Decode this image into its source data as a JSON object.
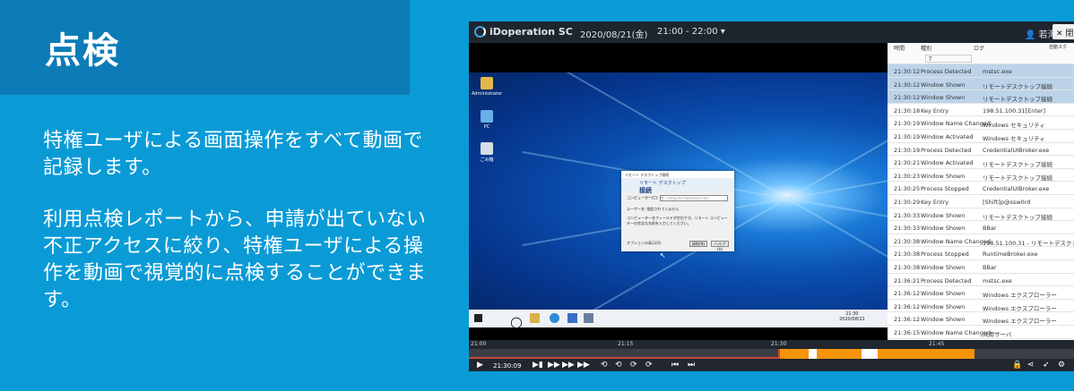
{
  "heading": "点検",
  "description": {
    "p1": "特権ユーザによる画面操作をすべて動画で記録します。",
    "p2": "利用点検レポートから、申請が出ていない不正アクセスに絞り、特権ユーザによる操作を動画で視覚的に点検することができます。"
  },
  "app": {
    "brand": "iDoperation SC",
    "date": "2020/08/21(金)",
    "time_range": "21:00 - 22:00",
    "user": "若海",
    "close_label": "閉じ",
    "header_right": "自動スク"
  },
  "desktop": {
    "icons": [
      "Administrator",
      "PC",
      "ごみ箱"
    ],
    "dialog": {
      "window_title": "リモート デスクトップ接続",
      "header_line1": "リモート デスクトップ",
      "header_line2": "接続",
      "computer_label": "コンピューター(C):",
      "computer_placeholder": "例: computer.fabrikam.com",
      "user_label": "ユーザー名:",
      "user_value": "指定されていません",
      "note": "コンピューター名フィールドが空白です。リモート コンピューターの完全な名前を入力してください。",
      "options": "オプションの表示(O)",
      "connect": "接続(N)",
      "help": "ヘルプ(H)"
    },
    "taskbar_clock": {
      "time": "21:30",
      "date": "2020/08/21"
    }
  },
  "log": {
    "columns": [
      "時間",
      "種別",
      "ログ"
    ],
    "filter_value": "T",
    "rows": [
      {
        "time": "21:30:12",
        "type": "Process Detected",
        "log": "mstsc.exe",
        "selected": true
      },
      {
        "time": "21:30:12",
        "type": "Window Shown",
        "log": "リモートデスクトップ接続",
        "selected": true
      },
      {
        "time": "21:30:12",
        "type": "Window Shown",
        "log": "リモートデスクトップ接続",
        "selected": true
      },
      {
        "time": "21:30:18",
        "type": "Key Entry",
        "log": "198.51.100.31[Enter]",
        "selected": false
      },
      {
        "time": "21:30:19",
        "type": "Window Name Changed",
        "log": "Windows セキュリティ",
        "selected": false
      },
      {
        "time": "21:30:19",
        "type": "Window Activated",
        "log": "Windows セキュリティ",
        "selected": false
      },
      {
        "time": "21:30:19",
        "type": "Process Detected",
        "log": "CredentialUIBroker.exe",
        "selected": false
      },
      {
        "time": "21:30:21",
        "type": "Window Activated",
        "log": "リモートデスクトップ接続",
        "selected": false
      },
      {
        "time": "21:30:23",
        "type": "Window Shown",
        "log": "リモートデスクトップ接続",
        "selected": false
      },
      {
        "time": "21:30:25",
        "type": "Process Stopped",
        "log": "CredentialUIBroker.exe",
        "selected": false
      },
      {
        "time": "21:30:29",
        "type": "Key Entry",
        "log": "[Shift]p@ssw0rd",
        "selected": false
      },
      {
        "time": "21:30:33",
        "type": "Window Shown",
        "log": "リモートデスクトップ接続",
        "selected": false
      },
      {
        "time": "21:30:33",
        "type": "Window Shown",
        "log": "BBar",
        "selected": false
      },
      {
        "time": "21:30:38",
        "type": "Window Name Changed",
        "log": "198.51.100.31 - リモートデスクトップ",
        "selected": false
      },
      {
        "time": "21:30:38",
        "type": "Process Stopped",
        "log": "RuntimeBroker.exe",
        "selected": false
      },
      {
        "time": "21:30:38",
        "type": "Window Shown",
        "log": "BBar",
        "selected": false
      },
      {
        "time": "21:36:21",
        "type": "Process Detected",
        "log": "mstsc.exe",
        "selected": false
      },
      {
        "time": "21:36:12",
        "type": "Window Shown",
        "log": "Windows エクスプローラー",
        "selected": false
      },
      {
        "time": "21:36:12",
        "type": "Window Shown",
        "log": "Windows エクスプローラー",
        "selected": false
      },
      {
        "time": "21:36:12",
        "type": "Window Shown",
        "log": "Windows エクスプローラー",
        "selected": false
      },
      {
        "time": "21:36:15",
        "type": "Window Name Changed",
        "log": "共用サーバ",
        "selected": false
      }
    ]
  },
  "timeline": {
    "ticks": [
      "21:00",
      "21:15",
      "21:30",
      "21:45"
    ],
    "current_time": "21:30:09",
    "colors": {
      "recorded": "#f5930a",
      "gap": "#ffffff",
      "played": "#c9463c"
    }
  }
}
